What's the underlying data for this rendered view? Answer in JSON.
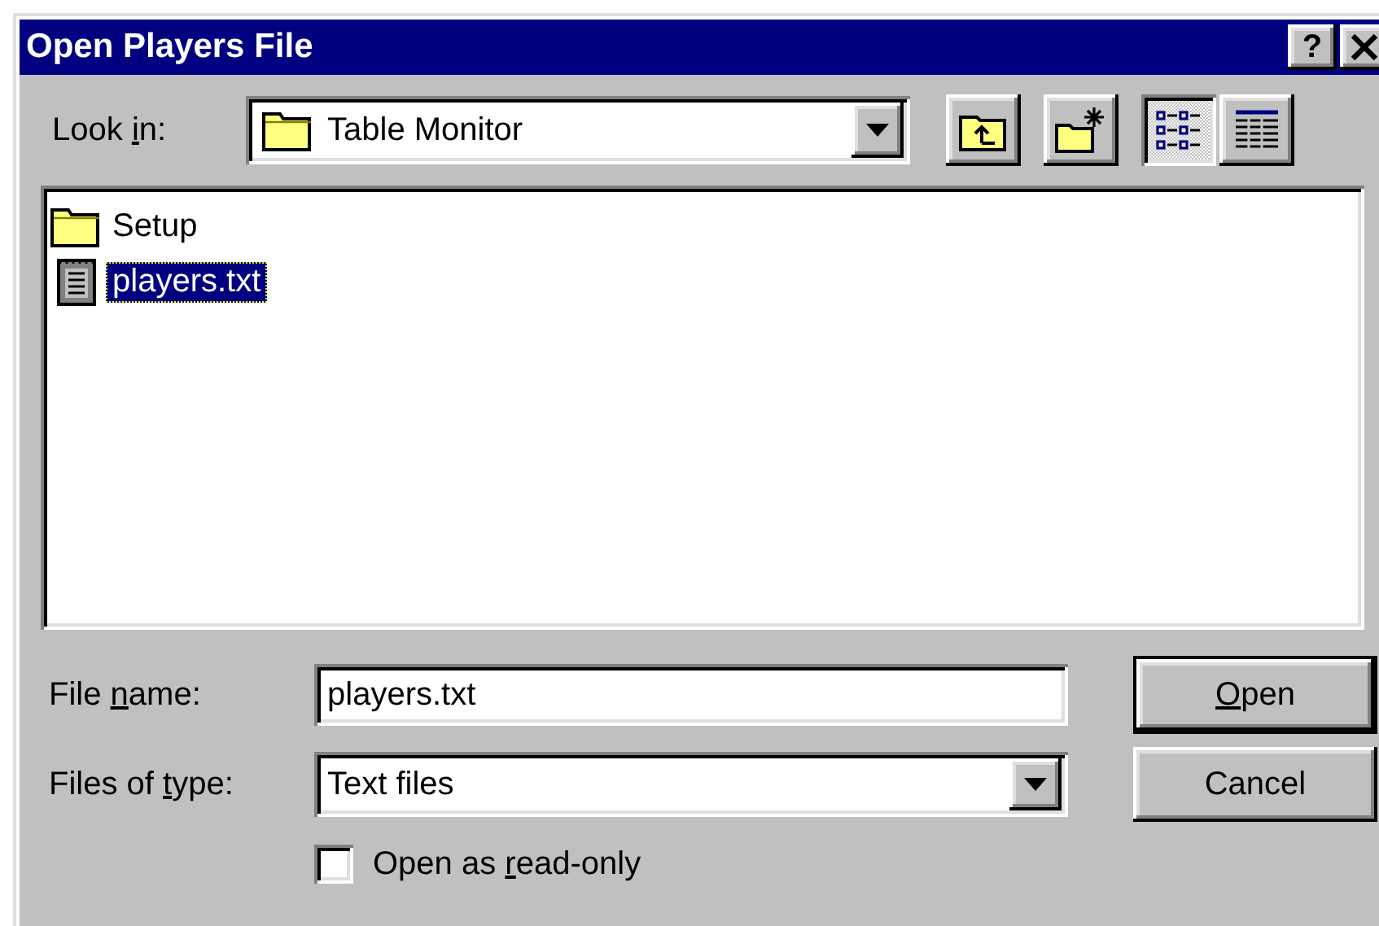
{
  "window": {
    "title": "Open Players File",
    "help_button": "?"
  },
  "look_in": {
    "label": {
      "pre": "Look ",
      "key": "i",
      "post": "n:"
    },
    "value": "Table Monitor"
  },
  "toolbar": [
    {
      "kind": "up-folder",
      "selected": false
    },
    {
      "kind": "new-folder",
      "selected": false
    },
    {
      "kind": "list-view",
      "selected": true
    },
    {
      "kind": "details-view",
      "selected": false
    }
  ],
  "files": [
    {
      "name": "Setup",
      "kind": "folder",
      "selected": false
    },
    {
      "name": "players.txt",
      "kind": "text-file",
      "selected": true
    }
  ],
  "file_name": {
    "label": {
      "pre": "File ",
      "key": "n",
      "post": "ame:"
    },
    "value": "players.txt"
  },
  "file_type": {
    "label": {
      "pre": "Files of ",
      "key": "t",
      "post": "ype:"
    },
    "value": "Text files"
  },
  "buttons": [
    {
      "label": {
        "key": "O",
        "post": "pen"
      },
      "default": true
    },
    {
      "label": {
        "text": "Cancel"
      },
      "default": false
    }
  ],
  "read_only": {
    "label": {
      "pre": "Open as ",
      "key": "r",
      "post": "ead-only"
    },
    "checked": false
  }
}
